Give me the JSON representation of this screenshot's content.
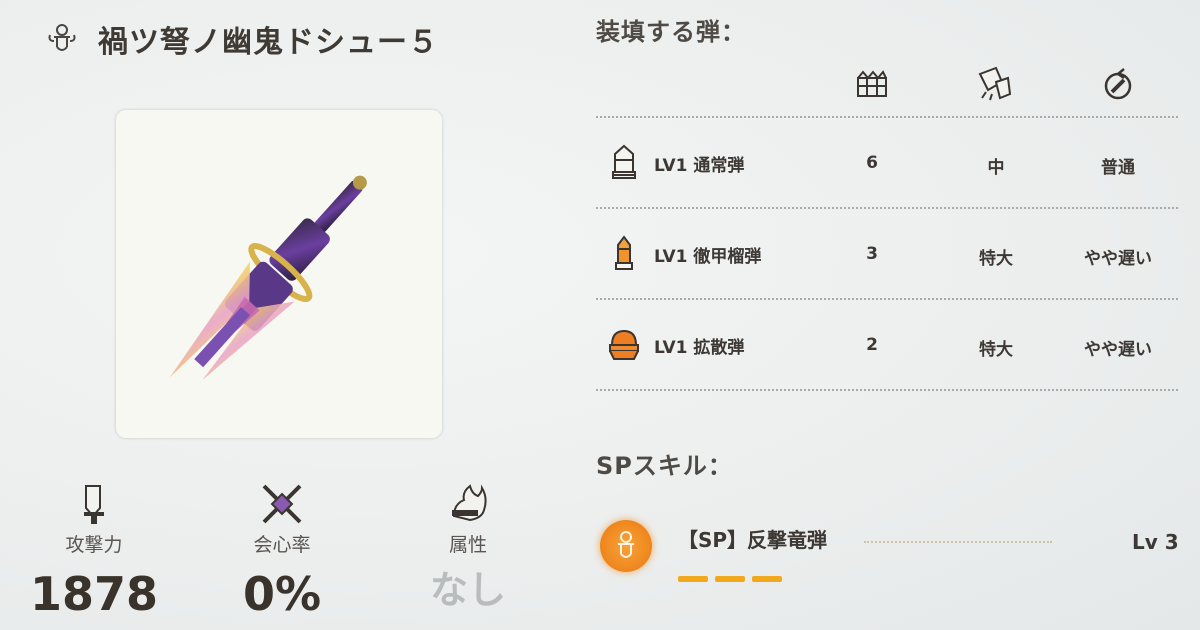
{
  "weapon": {
    "name": "禍ツ弩ノ幽鬼ドシュー５",
    "type_icon": "bowgun-type-icon"
  },
  "stats": [
    {
      "label": "攻撃力",
      "value": "1878",
      "icon": "sword-icon"
    },
    {
      "label": "会心率",
      "value": "0%",
      "icon": "crossed-blades-icon"
    },
    {
      "label": "属性",
      "value": "なし",
      "icon": "element-flame-icon"
    }
  ],
  "ammo": {
    "heading": "装填する弾：",
    "columns": [
      "capacity-icon",
      "recoil-icon",
      "reload-icon"
    ],
    "rows": [
      {
        "icon": "normal-ammo-icon",
        "name": "LV1 通常弾",
        "capacity": "6",
        "recoil": "中",
        "reload": "普通"
      },
      {
        "icon": "pierce-ammo-icon",
        "name": "LV1 徹甲榴弾",
        "capacity": "3",
        "recoil": "特大",
        "reload": "やや遅い"
      },
      {
        "icon": "spread-ammo-icon",
        "name": "LV1 拡散弾",
        "capacity": "2",
        "recoil": "特大",
        "reload": "やや遅い"
      }
    ]
  },
  "sp": {
    "heading": "SPスキル：",
    "skill_name": "【SP】反撃竜弾",
    "level": "Lv 3",
    "gauge_segments": 3,
    "accent": "#f08a20"
  }
}
